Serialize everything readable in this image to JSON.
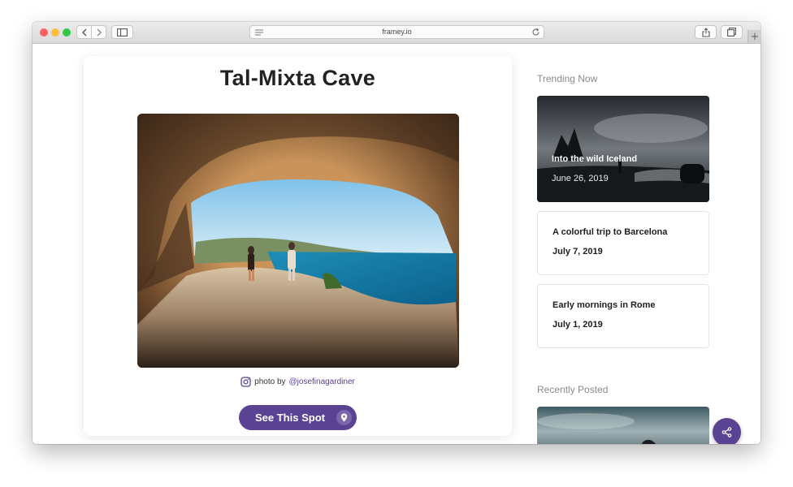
{
  "browser": {
    "url": "framey.io"
  },
  "spot": {
    "title": "Tal-Mixta Cave",
    "credit_prefix": "photo by",
    "credit_handle": "@josefinagardiner",
    "cta_label": "See This Spot"
  },
  "sidebar": {
    "trending_label": "Trending Now",
    "trending": [
      {
        "title": "Into the wild Iceland",
        "date": "June 26, 2019"
      },
      {
        "title": "A colorful trip to Barcelona",
        "date": "July 7, 2019"
      },
      {
        "title": "Early mornings in Rome",
        "date": "July 1, 2019"
      }
    ],
    "recent_label": "Recently Posted"
  },
  "colors": {
    "brand": "#5b4393",
    "text": "#222222",
    "muted": "#8a8a8a"
  },
  "icons": {
    "instagram": "instagram-icon",
    "pin": "map-pin-icon",
    "share": "share-icon"
  }
}
